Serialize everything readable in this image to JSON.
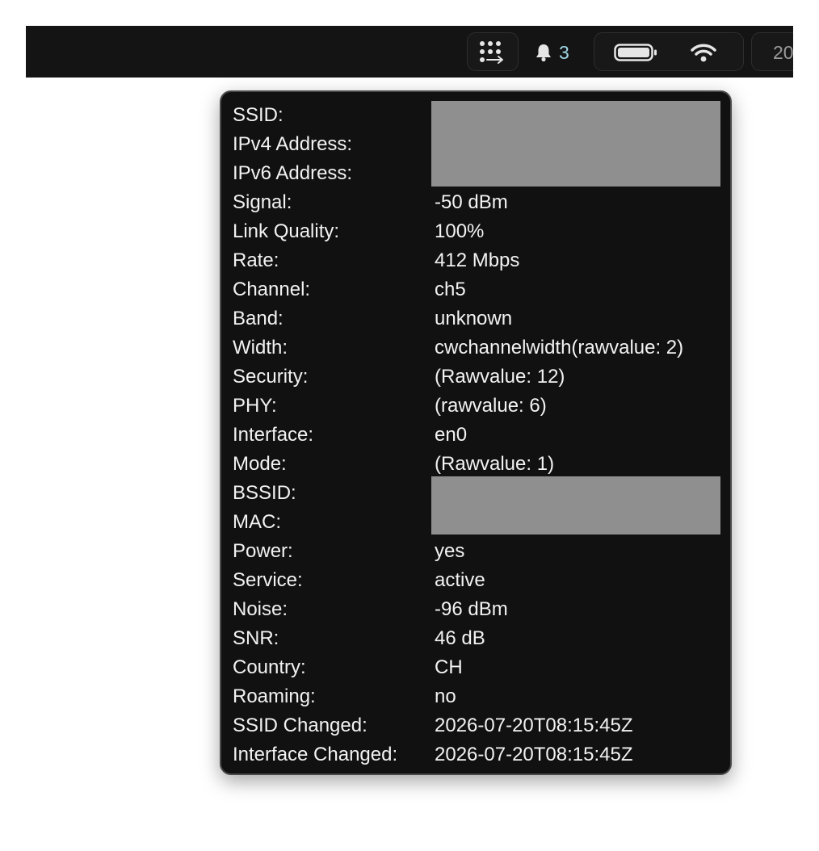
{
  "menubar": {
    "notifications_count": "3",
    "clock_text": "20",
    "icons": {
      "apps": "apps-grid-icon",
      "bell": "bell-icon",
      "battery": "battery-icon",
      "wifi": "wifi-icon"
    }
  },
  "wifi_details": {
    "rows": [
      {
        "label": "SSID:",
        "value": ""
      },
      {
        "label": "IPv4 Address:",
        "value": ""
      },
      {
        "label": "IPv6 Address:",
        "value": ""
      },
      {
        "label": "Signal:",
        "value": "-50 dBm"
      },
      {
        "label": "Link Quality:",
        "value": "100%"
      },
      {
        "label": "Rate:",
        "value": "412 Mbps"
      },
      {
        "label": "Channel:",
        "value": "ch5"
      },
      {
        "label": "Band:",
        "value": "unknown"
      },
      {
        "label": "Width:",
        "value": "cwchannelwidth(rawvalue: 2)"
      },
      {
        "label": "Security:",
        "value": "(Rawvalue: 12)"
      },
      {
        "label": "PHY:",
        "value": "(rawvalue: 6)"
      },
      {
        "label": "Interface:",
        "value": "en0"
      },
      {
        "label": "Mode:",
        "value": "(Rawvalue: 1)"
      },
      {
        "label": "BSSID:",
        "value": ""
      },
      {
        "label": "MAC:",
        "value": ""
      },
      {
        "label": "Power:",
        "value": "yes"
      },
      {
        "label": "Service:",
        "value": "active"
      },
      {
        "label": "Noise:",
        "value": "-96 dBm"
      },
      {
        "label": "SNR:",
        "value": "46 dB"
      },
      {
        "label": "Country:",
        "value": "CH"
      },
      {
        "label": "Roaming:",
        "value": "no"
      },
      {
        "label": "SSID Changed:",
        "value": "2026-07-20T08:15:45Z"
      },
      {
        "label": "Interface Changed:",
        "value": "2026-07-20T08:15:45Z"
      }
    ]
  },
  "colors": {
    "menubar_bg": "#141414",
    "popover_bg": "#111111",
    "text": "#f2f2f2",
    "redaction": "#8f8f8f",
    "badge_accent": "#9fd6e6"
  }
}
